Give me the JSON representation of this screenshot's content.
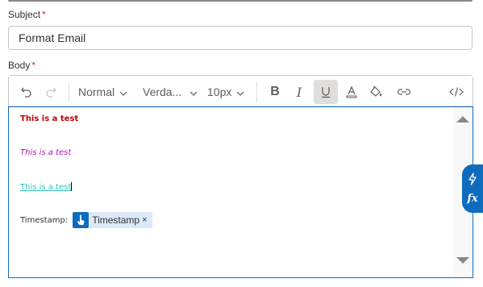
{
  "subject": {
    "label": "Subject",
    "required_mark": "*",
    "value": "Format Email"
  },
  "body": {
    "label": "Body",
    "required_mark": "*"
  },
  "toolbar": {
    "undo_icon": "undo-icon",
    "redo_icon": "redo-icon",
    "paragraph_style": "Normal",
    "font_family": "Verda...",
    "font_size": "10px",
    "bold_icon": "bold-icon",
    "italic_icon": "italic-icon",
    "underline_icon": "underline-icon",
    "underline_active": true,
    "font_color_icon": "font-color-icon",
    "highlight_icon": "paint-bucket-icon",
    "link_icon": "link-icon",
    "code_icon": "code-view-icon"
  },
  "content": {
    "line1": "This is a test",
    "line2": "This is a test",
    "line3": "This is a test",
    "timestamp_label": "Timestamp:",
    "token_label": "Timestamp",
    "token_remove": "×"
  },
  "side_panel": {
    "dynamic_icon": "lightning-icon",
    "fx_label": "fx"
  },
  "colors": {
    "accent": "#0f6cbd",
    "line1": "#c00000",
    "line2": "#b014b0",
    "line3": "#2ec4b6",
    "required": "#c4314b"
  }
}
